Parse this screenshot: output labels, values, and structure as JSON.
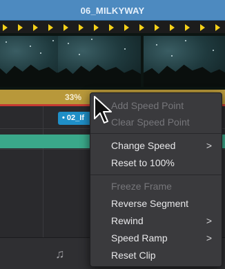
{
  "clip": {
    "title": "06_MILKYWAY"
  },
  "speed_bar": {
    "percent_label": "33%"
  },
  "sub_clip": {
    "label": "• 02_If"
  },
  "menu": {
    "items": [
      {
        "label": "Add Speed Point",
        "enabled": false,
        "submenu": false
      },
      {
        "label": "Clear Speed Point",
        "enabled": false,
        "submenu": false
      },
      {
        "label": "Change Speed",
        "enabled": true,
        "submenu": true
      },
      {
        "label": "Reset to 100%",
        "enabled": true,
        "submenu": false
      },
      {
        "label": "Freeze Frame",
        "enabled": false,
        "submenu": false
      },
      {
        "label": "Reverse Segment",
        "enabled": true,
        "submenu": false
      },
      {
        "label": "Rewind",
        "enabled": true,
        "submenu": true
      },
      {
        "label": "Speed Ramp",
        "enabled": true,
        "submenu": true
      },
      {
        "label": "Reset Clip",
        "enabled": true,
        "submenu": false
      }
    ],
    "submenu_chevron": ">"
  },
  "icons": {
    "music": "music-note-icon",
    "cursor": "mouse-pointer-icon",
    "speed_marker": "speed-marker-triangle-icon"
  },
  "colors": {
    "clip_header": "#4d8ac0",
    "speed_bar": "#b8983a",
    "speed_markers": "#f4d11a",
    "playhead_line": "#c63a32",
    "sub_clip": "#1f8fc7",
    "green_track": "#3aa88a",
    "menu_bg": "#3a3a3d"
  }
}
